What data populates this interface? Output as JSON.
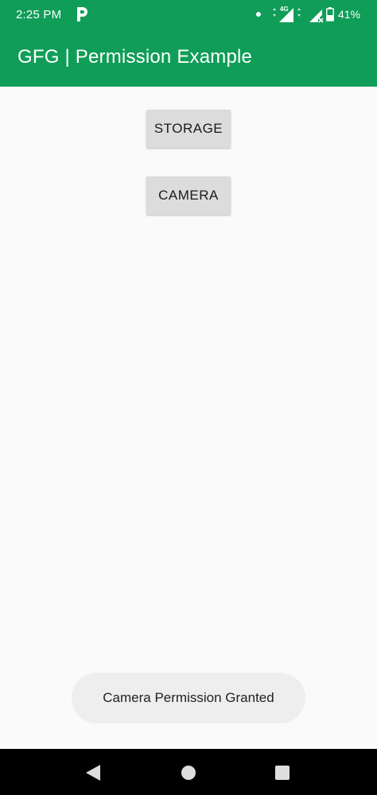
{
  "status_bar": {
    "time": "2:25 PM",
    "network": "4G",
    "battery": "41%",
    "icons": [
      "p-app-icon",
      "notification-dot-icon",
      "signal-4g-icon",
      "signal-no-sim-icon",
      "battery-icon"
    ]
  },
  "app_bar": {
    "title": "GFG | Permission Example",
    "color": "#0f9d58"
  },
  "buttons": {
    "storage_label": "STORAGE",
    "camera_label": "CAMERA"
  },
  "toast": {
    "message": "Camera Permission Granted"
  },
  "nav_bar": {
    "icons": [
      "back-icon",
      "home-icon",
      "recents-icon"
    ]
  }
}
